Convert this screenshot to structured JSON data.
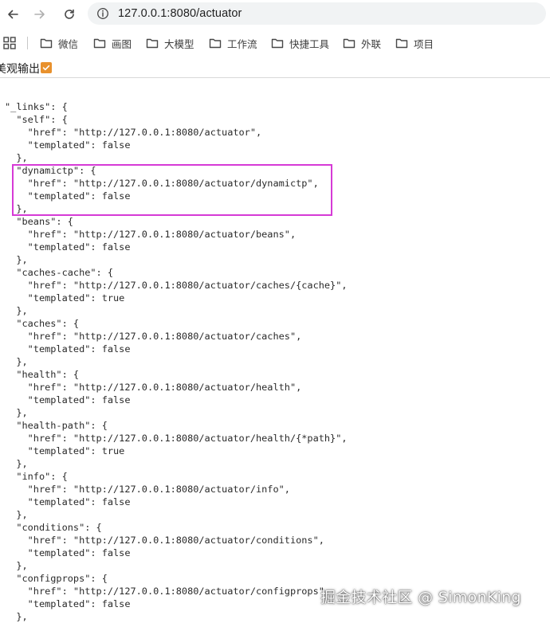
{
  "browser": {
    "url": "127.0.0.1:8080/actuator",
    "icons": {
      "back": "arrow-left-icon",
      "forward": "arrow-right-icon",
      "reload": "reload-icon",
      "site_info": "site-info-icon"
    }
  },
  "bookmarks": {
    "apps_icon": "apps-grid-icon",
    "items": [
      {
        "label": "微信"
      },
      {
        "label": "画图"
      },
      {
        "label": "大模型"
      },
      {
        "label": "工作流"
      },
      {
        "label": "快捷工具"
      },
      {
        "label": "外联"
      },
      {
        "label": "项目"
      }
    ]
  },
  "pretty_print": {
    "label": "美观输出",
    "checked": true,
    "accent": "#e8912d"
  },
  "json_lines": [
    "\"_links\": {",
    "  \"self\": {",
    "    \"href\": \"http://127.0.0.1:8080/actuator\",",
    "    \"templated\": false",
    "  },",
    "  \"dynamictp\": {",
    "    \"href\": \"http://127.0.0.1:8080/actuator/dynamictp\",",
    "    \"templated\": false",
    "  },",
    "  \"beans\": {",
    "    \"href\": \"http://127.0.0.1:8080/actuator/beans\",",
    "    \"templated\": false",
    "  },",
    "  \"caches-cache\": {",
    "    \"href\": \"http://127.0.0.1:8080/actuator/caches/{cache}\",",
    "    \"templated\": true",
    "  },",
    "  \"caches\": {",
    "    \"href\": \"http://127.0.0.1:8080/actuator/caches\",",
    "    \"templated\": false",
    "  },",
    "  \"health\": {",
    "    \"href\": \"http://127.0.0.1:8080/actuator/health\",",
    "    \"templated\": false",
    "  },",
    "  \"health-path\": {",
    "    \"href\": \"http://127.0.0.1:8080/actuator/health/{*path}\",",
    "    \"templated\": true",
    "  },",
    "  \"info\": {",
    "    \"href\": \"http://127.0.0.1:8080/actuator/info\",",
    "    \"templated\": false",
    "  },",
    "  \"conditions\": {",
    "    \"href\": \"http://127.0.0.1:8080/actuator/conditions\",",
    "    \"templated\": false",
    "  },",
    "  \"configprops\": {",
    "    \"href\": \"http://127.0.0.1:8080/actuator/configprops\",",
    "    \"templated\": false",
    "  },"
  ],
  "highlight": {
    "color": "#d63ad6",
    "target": "dynamictp"
  },
  "watermark": "掘金技术社区 @ SimonKing"
}
